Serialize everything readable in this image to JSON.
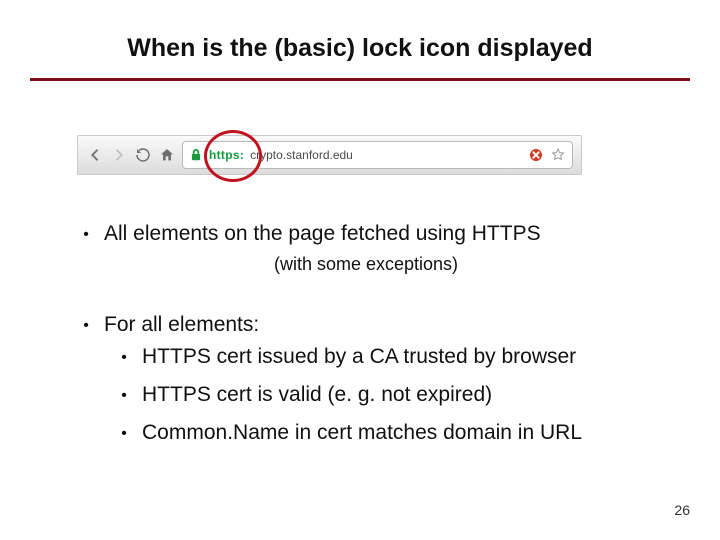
{
  "title": "When is the (basic) lock icon displayed",
  "url": {
    "scheme": "https:",
    "domain": "crypto.stanford.edu"
  },
  "bullets": {
    "l1a": "All elements on the page fetched using HTTPS",
    "l1a_sub": "(with some exceptions)",
    "l1b": "For all elements:",
    "l2a": "HTTPS cert issued by a CA trusted by browser",
    "l2b": "HTTPS cert is valid   (e. g. not expired)",
    "l2c": "Common.Name in cert matches domain in URL"
  },
  "pagenum": "26"
}
